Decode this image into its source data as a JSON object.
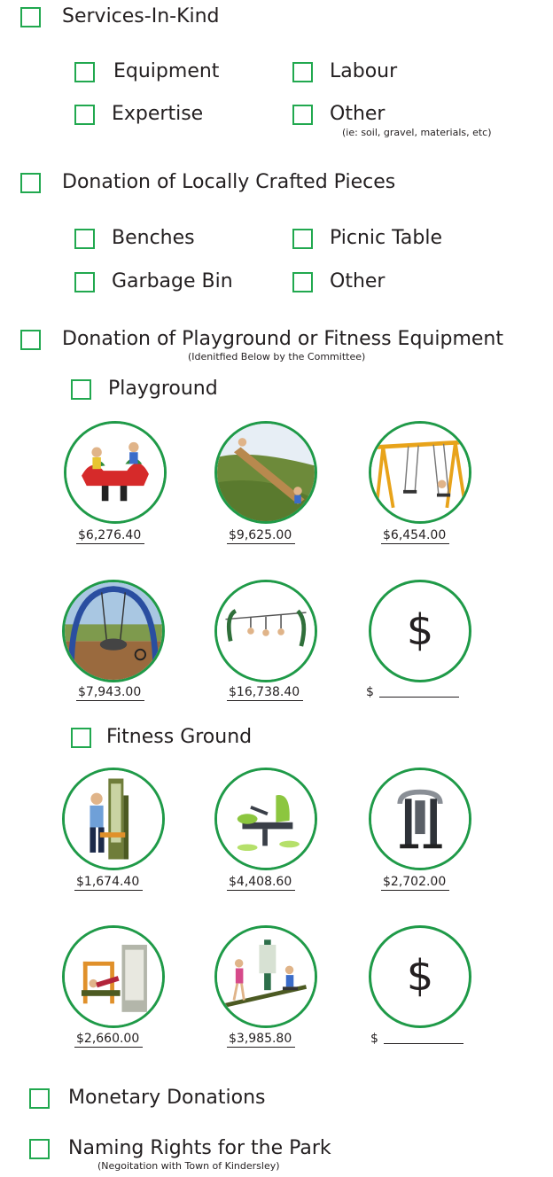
{
  "services_in_kind": {
    "label": "Services-In-Kind",
    "options": {
      "equipment": "Equipment",
      "labour": "Labour",
      "expertise": "Expertise",
      "other": "Other",
      "other_note": "(ie: soil, gravel, materials, etc)"
    }
  },
  "local_crafted": {
    "label": "Donation of Locally Crafted Pieces",
    "options": {
      "benches": "Benches",
      "picnic_table": "Picnic Table",
      "garbage_bin": "Garbage Bin",
      "other": "Other"
    }
  },
  "playground_fitness": {
    "label": "Donation of Playground or Fitness Equipment",
    "note": "(Idenitfied Below by the Committee)"
  },
  "playground": {
    "label": "Playground",
    "items": [
      {
        "price": "$6,276.40",
        "image": "seesaw-spring-rider-photo"
      },
      {
        "price": "$9,625.00",
        "image": "hill-slide-photo"
      },
      {
        "price": "$6,454.00",
        "image": "swing-set-photo"
      },
      {
        "price": "$7,943.00",
        "image": "arch-swing-photo"
      },
      {
        "price": "$16,738.40",
        "image": "zipline-photo"
      }
    ],
    "custom": {
      "symbol": "$",
      "label": "$"
    }
  },
  "fitness": {
    "label": "Fitness Ground",
    "items": [
      {
        "price": "$1,674.40",
        "image": "stretch-station-photo"
      },
      {
        "price": "$4,408.60",
        "image": "rowing-machine-photo"
      },
      {
        "price": "$2,702.00",
        "image": "air-walker-photo"
      },
      {
        "price": "$2,660.00",
        "image": "workout-bench-station-photo"
      },
      {
        "price": "$3,985.80",
        "image": "fitness-circuit-photo"
      }
    ],
    "custom": {
      "symbol": "$",
      "label": "$"
    }
  },
  "monetary": {
    "label": "Monetary Donations"
  },
  "naming_rights": {
    "label": "Naming Rights for the Park",
    "note": "(Negoitation with Town of Kindersley)"
  },
  "colors": {
    "accent": "#21a84f",
    "text": "#231f20"
  }
}
